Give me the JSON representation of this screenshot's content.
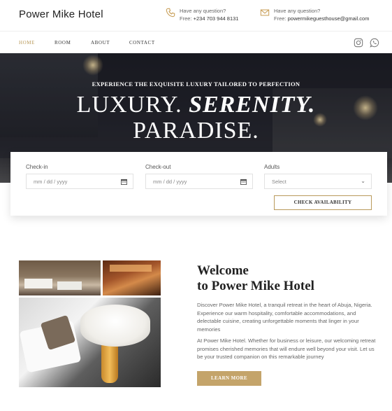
{
  "header": {
    "brand": "Power Mike Hotel",
    "phone": {
      "icon": "phone-icon",
      "label": "Have any question?",
      "prefix": "Free:",
      "value": "+234 703 944 8131"
    },
    "email": {
      "icon": "mail-icon",
      "label": "Have any question?",
      "prefix": "Free:",
      "value": "powermikeguesthouse@gmail.com"
    }
  },
  "nav": {
    "items": [
      {
        "label": "HOME",
        "active": true
      },
      {
        "label": "ROOM",
        "active": false
      },
      {
        "label": "ABOUT",
        "active": false
      },
      {
        "label": "CONTACT",
        "active": false
      }
    ],
    "social": [
      "instagram-icon",
      "whatsapp-icon"
    ]
  },
  "hero": {
    "kicker": "EXPERIENCE THE EXQUISITE LUXURY TAILORED TO PERFECTION",
    "line1_a": "LUXURY.",
    "line1_b": "SERENITY.",
    "line2": "PARADISE."
  },
  "booking": {
    "checkin_label": "Check-in",
    "checkin_placeholder": "mm / dd / yyyy",
    "checkout_label": "Check-out",
    "checkout_placeholder": "mm / dd / yyyy",
    "adults_label": "Adults",
    "adults_value": "Select",
    "submit_label": "CHECK AVAILABILITY"
  },
  "welcome": {
    "title_line1": "Welcome",
    "title_line2": "to Power Mike Hotel",
    "paragraph1": "Discover Power Mike Hotel, a tranquil retreat in the heart of Abuja, Nigeria. Experience our warm hospitality, comfortable accommodations, and delectable cuisine, creating unforgettable moments that linger in your memories",
    "paragraph2": "At Power Mike Hotel. Whether for business or leisure, our welcoming retreat promises cherished memories that will endure well beyond your visit. Let us be your trusted companion on this remarkable journey",
    "button_label": "LEARN MORE"
  },
  "colors": {
    "accent": "#b99a5b",
    "button": "#c4a46a"
  }
}
